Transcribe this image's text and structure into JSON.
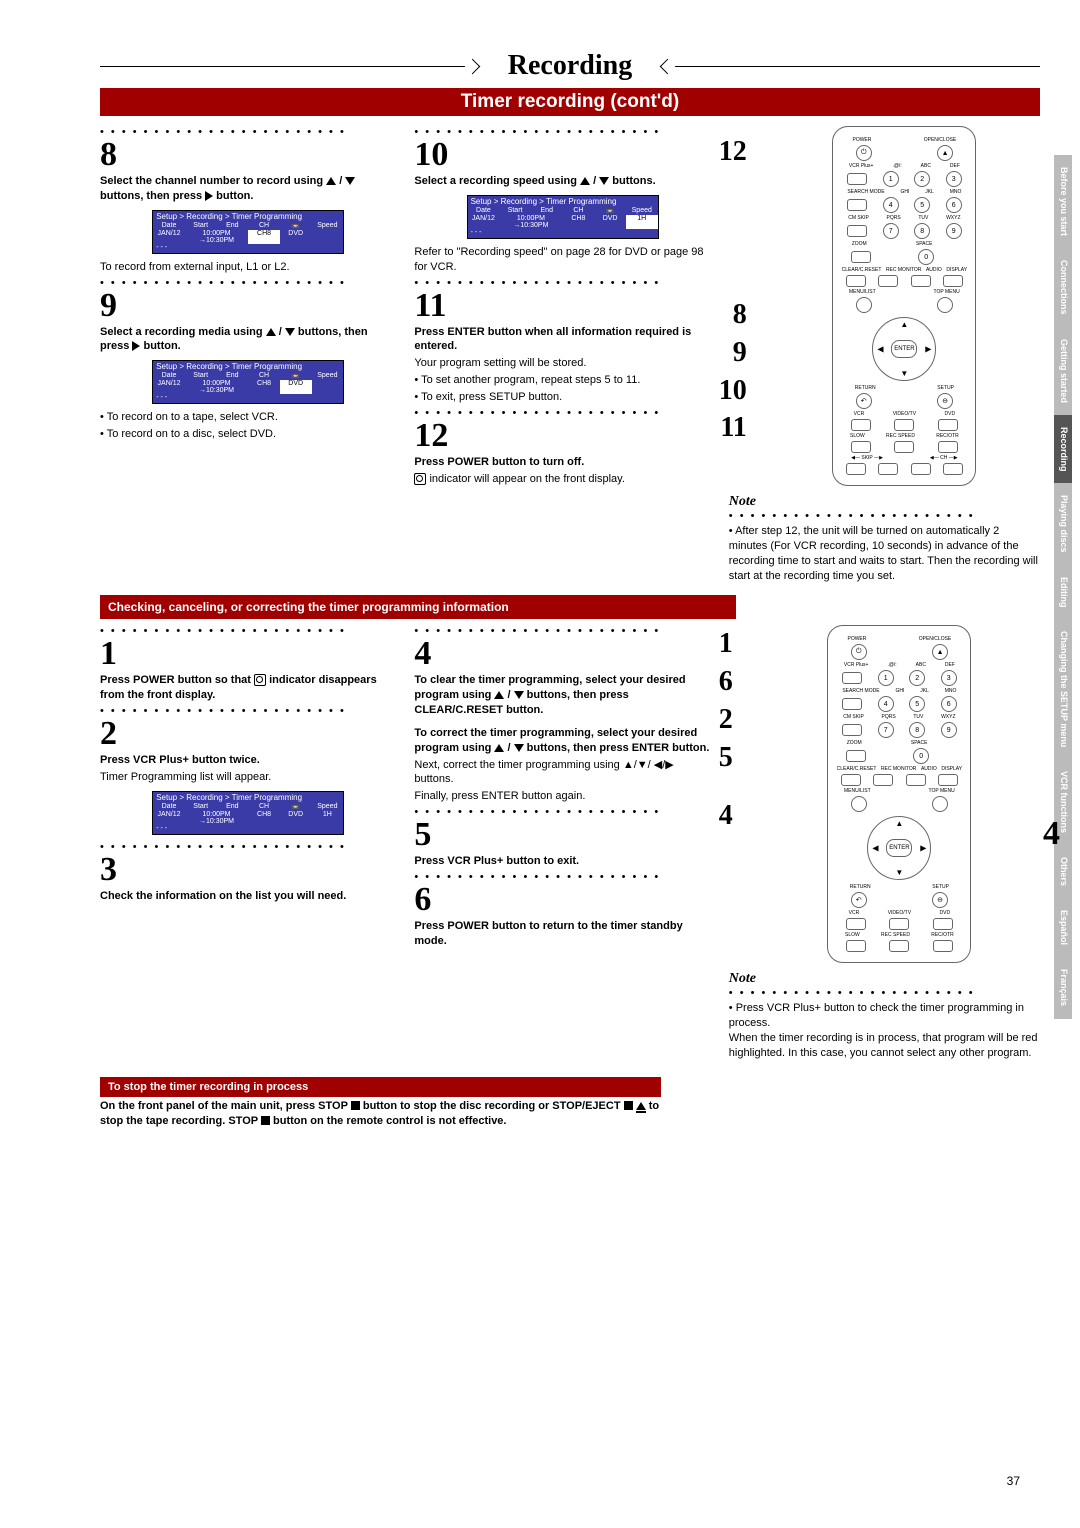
{
  "page_title": "Recording",
  "subtitle": "Timer recording (cont'd)",
  "page_number": "37",
  "tabs": [
    "Before you start",
    "Connections",
    "Getting started",
    "Recording",
    "Playing discs",
    "Editing",
    "Changing the SETUP menu",
    "VCR functions",
    "Others",
    "Español",
    "Français"
  ],
  "setupbox": {
    "header": "Setup > Recording > Timer Programming",
    "cols": [
      "Date",
      "Start",
      "End",
      "CH",
      "📼",
      "Speed"
    ]
  },
  "step8": {
    "num": "8",
    "head1": "Select the channel number to record using ",
    "head2": " / ",
    "head3": " buttons, then press ",
    "head4": " button.",
    "datarow": [
      "JAN/12",
      "10:00PM →10:30PM",
      "CH8",
      "DVD",
      ""
    ],
    "after": "To record from external input, L1 or L2."
  },
  "step9": {
    "num": "9",
    "head1": "Select a recording media using ",
    "head2": " / ",
    "head3": " buttons, then press ",
    "head4": " button.",
    "datarow": [
      "JAN/12",
      "10:00PM →10:30PM",
      "CH8",
      "DVD",
      ""
    ],
    "bul1": "• To record on to a tape, select VCR.",
    "bul2": "• To record on to a disc, select DVD."
  },
  "step10": {
    "num": "10",
    "head1": "Select a recording speed using ",
    "head2": " / ",
    "head3": " buttons.",
    "datarow": [
      "JAN/12",
      "10:00PM →10:30PM",
      "CH8",
      "DVD",
      "1H"
    ],
    "after": "Refer to \"Recording speed\" on page 28 for DVD or page 98 for VCR."
  },
  "step11": {
    "num": "11",
    "head": "Press ENTER button when all information required is entered.",
    "body": "Your program setting will be stored.",
    "bul1": "• To set another program, repeat steps 5 to 11.",
    "bul2": "• To exit, press SETUP button."
  },
  "step12": {
    "num": "12",
    "head": "Press POWER button to turn off.",
    "body": " indicator will appear on the front display."
  },
  "remote_nums_a": [
    "12",
    "8",
    "9",
    "10",
    "11"
  ],
  "note1": {
    "label": "Note",
    "text": "• After step 12, the unit will be turned on automatically 2 minutes (For VCR recording, 10 seconds) in advance of the recording time to start and waits to start. Then the recording will start at the recording time you set."
  },
  "check_header": "Checking, canceling, or correcting the timer programming information",
  "c1": {
    "num": "1",
    "head": "Press POWER button so that",
    "head2": " indicator disappears from the front display."
  },
  "c2": {
    "num": "2",
    "head": "Press VCR Plus+ button twice.",
    "body": "Timer Programming list will appear.",
    "datarow": [
      "JAN/12",
      "10:00PM →10:30PM",
      "CH8",
      "DVD",
      "1H"
    ]
  },
  "c3": {
    "num": "3",
    "head": "Check the information on the list you will need."
  },
  "c4": {
    "num": "4",
    "head1": "To clear the timer programming, select your desired program using ",
    "head2": " / ",
    "head3": " buttons, then press CLEAR/C.RESET button.",
    "head4": "To correct the timer programming, select your desired program using ",
    "head5": " / ",
    "head6": " buttons, then press ENTER button.",
    "body1": "Next, correct the timer programming using ▲/▼/ ◀/▶ buttons.",
    "body2": "Finally, press ENTER button again."
  },
  "c5": {
    "num": "5",
    "head": "Press VCR Plus+ button to exit."
  },
  "c6": {
    "num": "6",
    "head": "Press POWER button to return to the timer standby mode."
  },
  "remote_nums_b": [
    "1",
    "6",
    "2",
    "5",
    "4"
  ],
  "remote_call_4": "4",
  "note2": {
    "label": "Note",
    "text": "• Press VCR Plus+ button to check the timer programming in process.\nWhen the timer recording is in process, that program will be red highlighted. In this case, you cannot select any other program."
  },
  "stop_header": "To stop the timer recording in process",
  "stop_body1": "On the front panel of the main unit, press STOP ",
  "stop_body2": " button to stop the disc recording or STOP/EJECT ",
  "stop_body3": " to stop the tape recording. STOP ",
  "stop_body4": " button on the remote control is not effective."
}
